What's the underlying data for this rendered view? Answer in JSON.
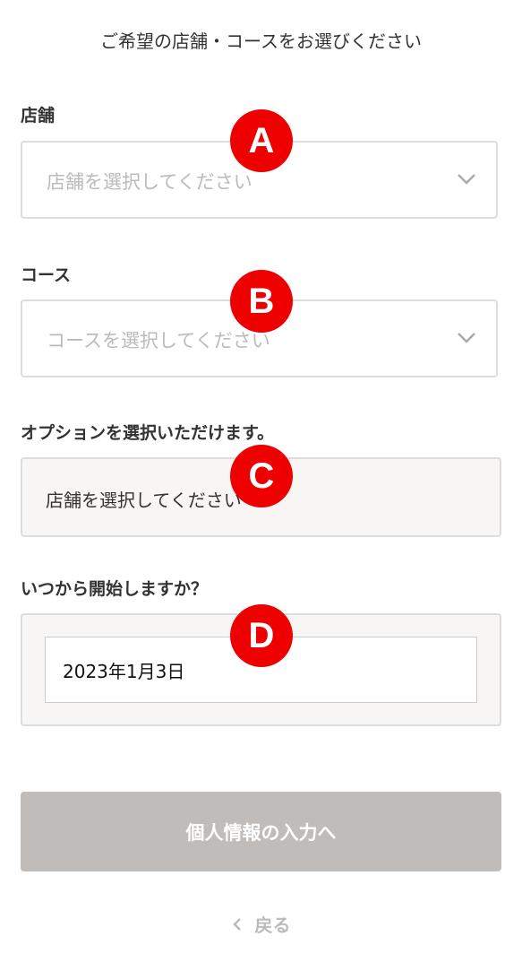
{
  "header": {
    "title": "ご希望の店舗・コースをお選びください"
  },
  "store": {
    "label": "店舗",
    "placeholder": "店舗を選択してください",
    "marker": "A",
    "icon": "chevron-down-icon"
  },
  "course": {
    "label": "コース",
    "placeholder": "コースを選択してください",
    "marker": "B",
    "icon": "chevron-down-icon"
  },
  "option": {
    "label": "オプションを選択いただけます。",
    "message": "店舗を選択してください",
    "marker": "C"
  },
  "start_date": {
    "label": "いつから開始しますか？",
    "value": "2023年1月3日",
    "marker": "D"
  },
  "actions": {
    "next_label": "個人情報の入力へ",
    "back_label": "戻る",
    "back_icon": "chevron-left-icon"
  },
  "colors": {
    "marker": "#ee0000",
    "disabled_button": "#c0bcb9",
    "placeholder": "#bbbbbb",
    "panel_bg": "#f7f6f4"
  }
}
